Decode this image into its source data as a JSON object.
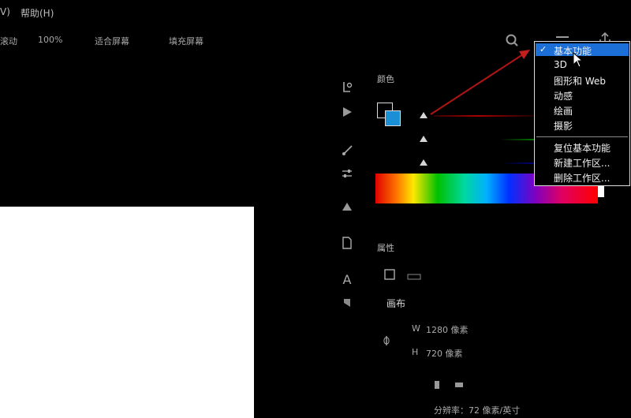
{
  "menubar": {
    "fragment": "V)",
    "help": "帮助(H)"
  },
  "options_bar": {
    "scroll_fragment": "滚动",
    "zoom": "100%",
    "fit_screen": "适合屏幕",
    "fill_screen": "填充屏幕"
  },
  "panels": {
    "color_title": "颜色",
    "color_values": [
      "",
      "",
      ""
    ],
    "properties_title": "属性",
    "canvas_label": "画布",
    "width_label": "W",
    "width_value": "1280 像素",
    "height_label": "H",
    "height_value": "720 像素",
    "resolution_text": "分辨率：72 像素/英寸"
  },
  "workspace_menu": {
    "items": [
      "基本功能",
      "3D",
      "图形和 Web",
      "动感",
      "绘画",
      "摄影"
    ],
    "actions": [
      "复位基本功能",
      "新建工作区...",
      "删除工作区..."
    ],
    "checked_index": 0
  },
  "colors": {
    "accent_blue": "#1b8fd6",
    "selection_red": "#c41e1e",
    "menu_border": "#dcdcdc"
  },
  "icons": [
    "search-icon",
    "workspace-icon",
    "share-icon",
    "play-icon",
    "brush-icon",
    "sliders-icon",
    "triangle-icon",
    "file-icon",
    "text-icon",
    "paragraph-icon",
    "link-icon",
    "cursor-icon"
  ]
}
